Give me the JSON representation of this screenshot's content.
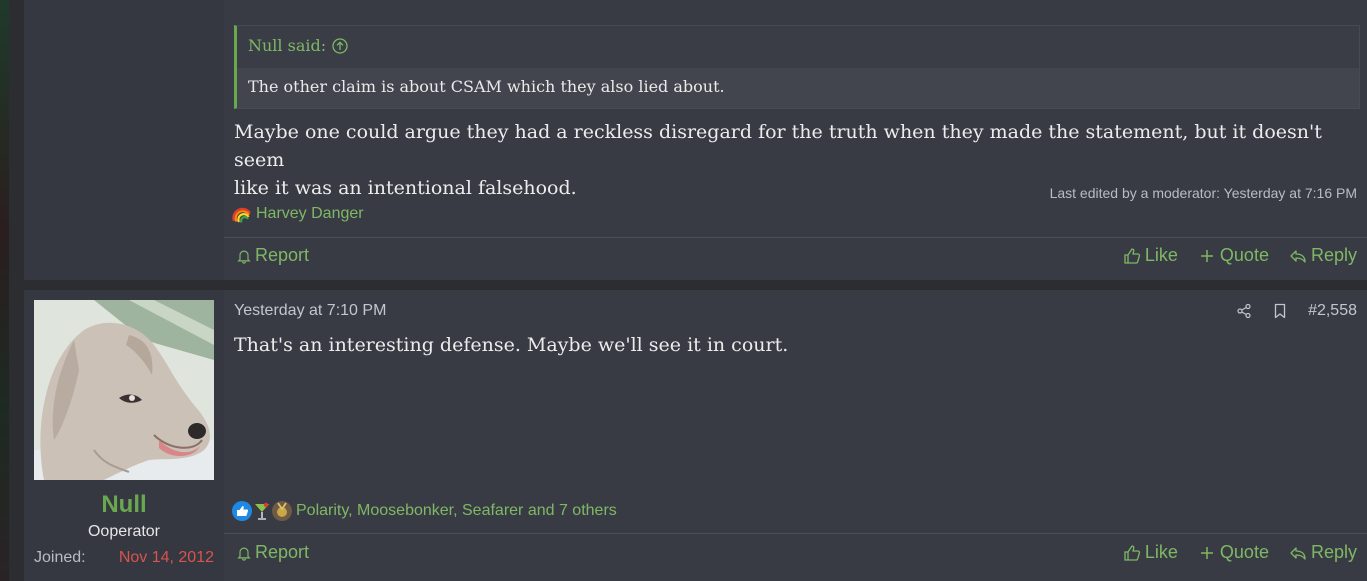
{
  "post_prev": {
    "quote": {
      "author_said": "Null said:",
      "text": "The other claim is about CSAM which they also lied about."
    },
    "body_lines": [
      "Maybe one could argue they had a reckless disregard for the truth when they made the statement, but it doesn't seem",
      "like it was an intentional falsehood."
    ],
    "edited": "Last edited by a moderator: Yesterday at 7:16 PM",
    "reactions_text": "Harvey Danger",
    "actions": {
      "report": "Report",
      "like": "Like",
      "quote": "Quote",
      "reply": "Reply"
    }
  },
  "post": {
    "user": {
      "name": "Null",
      "title": "Ooperator",
      "joined_label": "Joined:",
      "joined_date": "Nov 14, 2012"
    },
    "date": "Yesterday at 7:10 PM",
    "number": "#2,558",
    "body": "That's an interesting defense. Maybe we'll see it in court.",
    "reactions_text": "Polarity, Moosebonker, Seafarer and 7 others",
    "actions": {
      "report": "Report",
      "like": "Like",
      "quote": "Quote",
      "reply": "Reply"
    }
  },
  "colors": {
    "accent_green": "#6aa84f",
    "link_green": "#7fb865",
    "joined_red": "#d9534f",
    "post_bg": "#383b44",
    "page_bg": "#2b2d31"
  },
  "icons": [
    "arrow-up-circle-icon",
    "rainbow-reaction-icon",
    "bell-icon",
    "thumbs-up-icon",
    "plus-icon",
    "reply-icon",
    "share-icon",
    "bookmark-icon",
    "like-reaction-icon",
    "cocktail-reaction-icon",
    "medal-reaction-icon"
  ]
}
